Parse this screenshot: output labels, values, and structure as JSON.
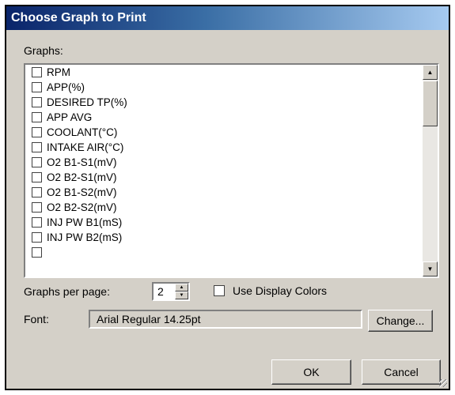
{
  "dialog": {
    "title": "Choose Graph to Print",
    "graphs_label": "Graphs:",
    "graphs": [
      {
        "label": "RPM",
        "checked": false
      },
      {
        "label": "APP(%)",
        "checked": false
      },
      {
        "label": "DESIRED TP(%)",
        "checked": false
      },
      {
        "label": "APP AVG",
        "checked": false
      },
      {
        "label": "COOLANT(°C)",
        "checked": false
      },
      {
        "label": "INTAKE AIR(°C)",
        "checked": false
      },
      {
        "label": "O2 B1-S1(mV)",
        "checked": false
      },
      {
        "label": "O2 B2-S1(mV)",
        "checked": false
      },
      {
        "label": "O2 B1-S2(mV)",
        "checked": false
      },
      {
        "label": "O2 B2-S2(mV)",
        "checked": false
      },
      {
        "label": "INJ PW B1(mS)",
        "checked": false
      },
      {
        "label": "INJ PW B2(mS)",
        "checked": false
      },
      {
        "label": "",
        "checked": false
      }
    ],
    "graphs_per_page_label": "Graphs per page:",
    "graphs_per_page_value": "2",
    "use_display_colors_label": "Use Display Colors",
    "use_display_colors_checked": false,
    "font_label": "Font:",
    "font_value": "Arial Regular 14.25pt",
    "change_button": "Change...",
    "ok_button": "OK",
    "cancel_button": "Cancel"
  },
  "icons": {
    "scroll_up": "up-arrow-icon",
    "scroll_down": "down-arrow-icon",
    "spin_up": "up-arrow-icon",
    "spin_down": "down-arrow-icon"
  },
  "colors": {
    "title_gradient_start": "#0a246a",
    "title_gradient_end": "#a6caf0",
    "dialog_background": "#d4d0c8"
  }
}
